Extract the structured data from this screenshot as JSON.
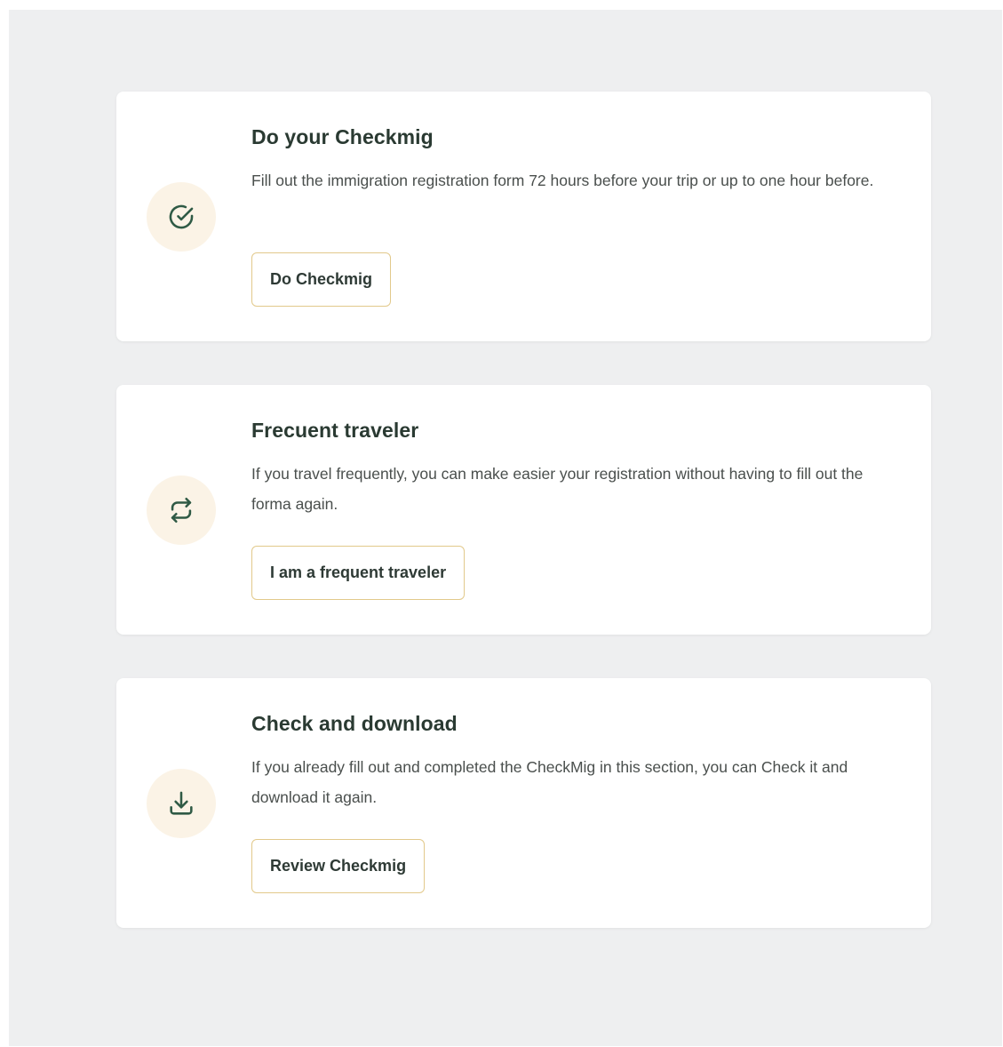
{
  "cards": [
    {
      "icon": "check-circle-icon",
      "title": "Do your Checkmig",
      "description": "Fill out the immigration registration form 72 hours before your trip or up to one hour before.",
      "button_label": "Do Checkmig"
    },
    {
      "icon": "repeat-arrows-icon",
      "title": "Frecuent traveler",
      "description": "If you travel frequently, you can make easier your registration without having to fill out the forma again.",
      "button_label": "I am a frequent traveler"
    },
    {
      "icon": "download-icon",
      "title": "Check and download",
      "description": "If you already fill out and completed the CheckMig in this section, you can Check it and download it again.",
      "button_label": "Review Checkmig"
    }
  ],
  "colors": {
    "page_background": "#eeeff0",
    "card_background": "#ffffff",
    "icon_circle": "#fbf3e6",
    "icon_stroke": "#2f5a45",
    "button_border": "#e2c98b",
    "title_text": "#2a3a32"
  }
}
